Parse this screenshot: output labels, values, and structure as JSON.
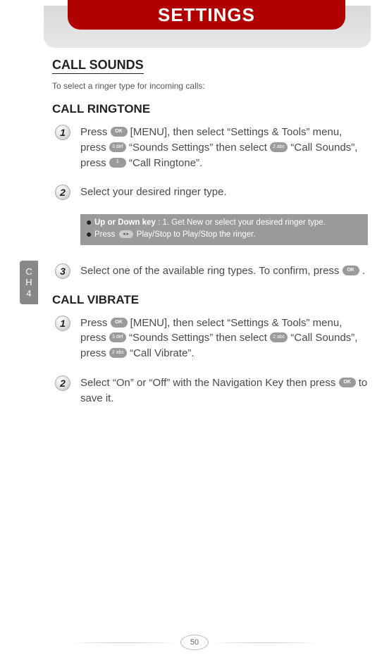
{
  "header": {
    "title": "SETTINGS"
  },
  "side_tab": {
    "line1": "C",
    "line2": "H",
    "line3": "4"
  },
  "page_number": "50",
  "keys": {
    "ok": "OK",
    "k1": "1",
    "k2": "2 abc",
    "k3": "3 def",
    "arrows": "◂ ▸"
  },
  "call_sounds": {
    "title": "CALL SOUNDS",
    "intro": "To select a ringer type for incoming calls:",
    "ringtone": {
      "title": "CALL RINGTONE",
      "steps": [
        {
          "n": "1",
          "parts": [
            "Press ",
            {
              "key": "ok"
            },
            " [MENU], then select “Settings & Tools” menu, press ",
            {
              "key": "k3"
            },
            " “Sounds Settings” then select ",
            {
              "key": "k2"
            },
            " “Call Sounds”, press ",
            {
              "key": "k1"
            },
            " “Call Ringtone”."
          ]
        },
        {
          "n": "2",
          "parts": [
            "Select your desired ringer type."
          ]
        },
        {
          "n": "3",
          "parts": [
            "Select one of the available ring types. To confirm, press ",
            {
              "key": "ok"
            },
            " ."
          ]
        }
      ],
      "tips": [
        {
          "bold": "Up or Down key",
          "rest": " : 1. Get New or select your desired ringer type."
        },
        {
          "plain_before": "Press ",
          "key": "arrows",
          "plain_after": " Play/Stop to Play/Stop the ringer."
        }
      ]
    },
    "vibrate": {
      "title": "CALL VIBRATE",
      "steps": [
        {
          "n": "1",
          "parts": [
            "Press ",
            {
              "key": "ok"
            },
            " [MENU], then select “Settings & Tools” menu, press ",
            {
              "key": "k3"
            },
            " “Sounds Settings” then select ",
            {
              "key": "k2"
            },
            " “Call Sounds”, press ",
            {
              "key": "k2"
            },
            " “Call Vibrate”."
          ]
        },
        {
          "n": "2",
          "parts": [
            "Select “On” or “Off” with the Navigation Key then press ",
            {
              "key": "ok"
            },
            " to save it."
          ]
        }
      ]
    }
  }
}
